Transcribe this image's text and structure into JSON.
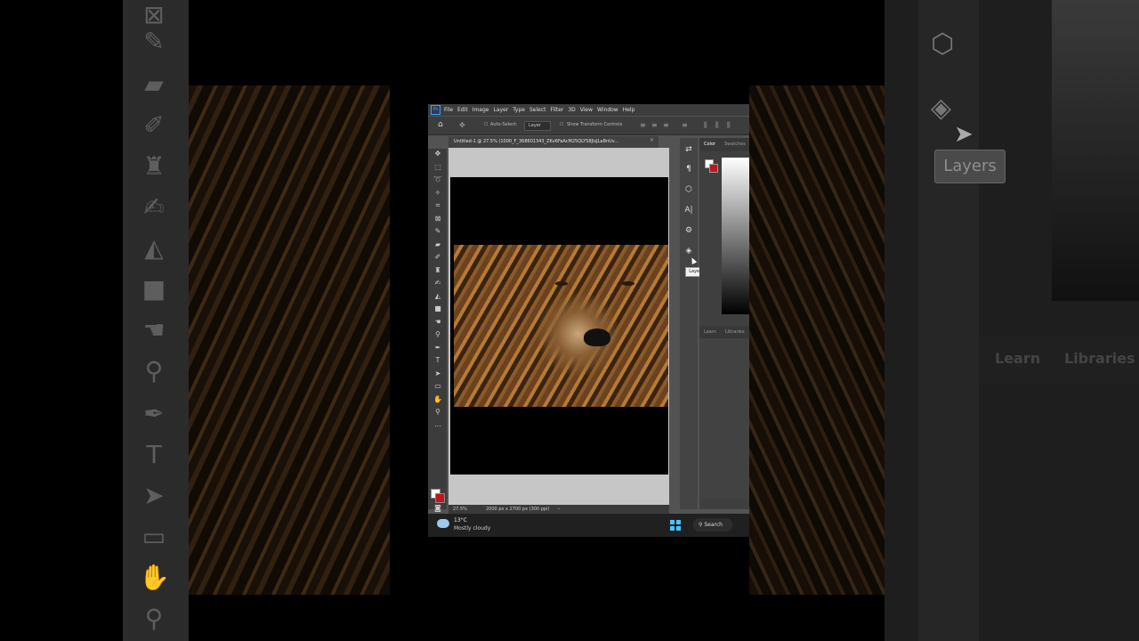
{
  "menubar": {
    "app_icon": "Ps",
    "items": [
      "File",
      "Edit",
      "Image",
      "Layer",
      "Type",
      "Select",
      "Filter",
      "3D",
      "View",
      "Window",
      "Help"
    ]
  },
  "options": {
    "auto_select_label": "Auto-Select:",
    "layer_select": "Layer",
    "show_transform": "Show Transform Controls"
  },
  "document": {
    "tab_title": "Untitled-1 @ 27.5% (1000_F_368601343_ZKv6FaAcM25QLYS8JlsJLaBnUv..."
  },
  "status": {
    "zoom": "27.5%",
    "doc_size": "2000 px x 2700 px (300 ppi)"
  },
  "right_panel": {
    "tab_color": "Color",
    "tab_swatches": "Swatches",
    "tab_learn": "Learn",
    "tab_libraries": "Libraries",
    "tooltip": "Layers"
  },
  "colors": {
    "foreground": "#ffffff",
    "background": "#c0161b"
  },
  "taskbar": {
    "temperature": "13°C",
    "condition": "Mostly cloudy",
    "search_label": "Search"
  },
  "background_zoom": {
    "tooltip": "Layers",
    "tab_learn": "Learn",
    "tab_libraries": "Libraries"
  }
}
